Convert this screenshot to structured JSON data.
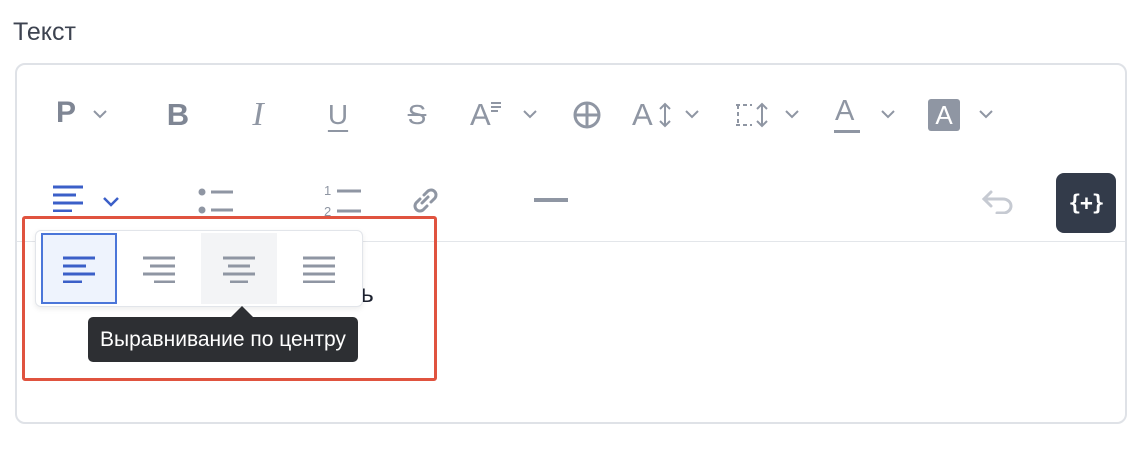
{
  "field": {
    "label": "Текст"
  },
  "toolbar": {
    "paragraph_label": "P",
    "bold_label": "B",
    "italic_label": "I",
    "underline_label": "U",
    "strike_label": "S",
    "font_size_label": "A",
    "line_height_label": "A",
    "font_color_label": "A",
    "bg_color_label": "A",
    "insert_variable_label": "{+}",
    "icons": [
      "paragraph-icon",
      "bold-icon",
      "italic-icon",
      "underline-icon",
      "strikethrough-icon",
      "font-size-icon",
      "emoji-icon",
      "text-height-icon",
      "line-spacing-icon",
      "font-color-icon",
      "background-color-icon",
      "align-left-icon",
      "bullet-list-icon",
      "numbered-list-icon",
      "link-icon",
      "horizontal-rule-icon",
      "undo-icon"
    ],
    "accent_color": "#3b5fc8",
    "icon_color": "#8f96a3"
  },
  "align_menu": {
    "options": [
      "align-left",
      "align-right",
      "align-center",
      "align-justify"
    ],
    "active": "align-left",
    "hovered": "align-center",
    "tooltip": "Выравнивание по центру"
  },
  "editor": {
    "visible_text": "вань"
  },
  "highlight_color": "#e0533f"
}
